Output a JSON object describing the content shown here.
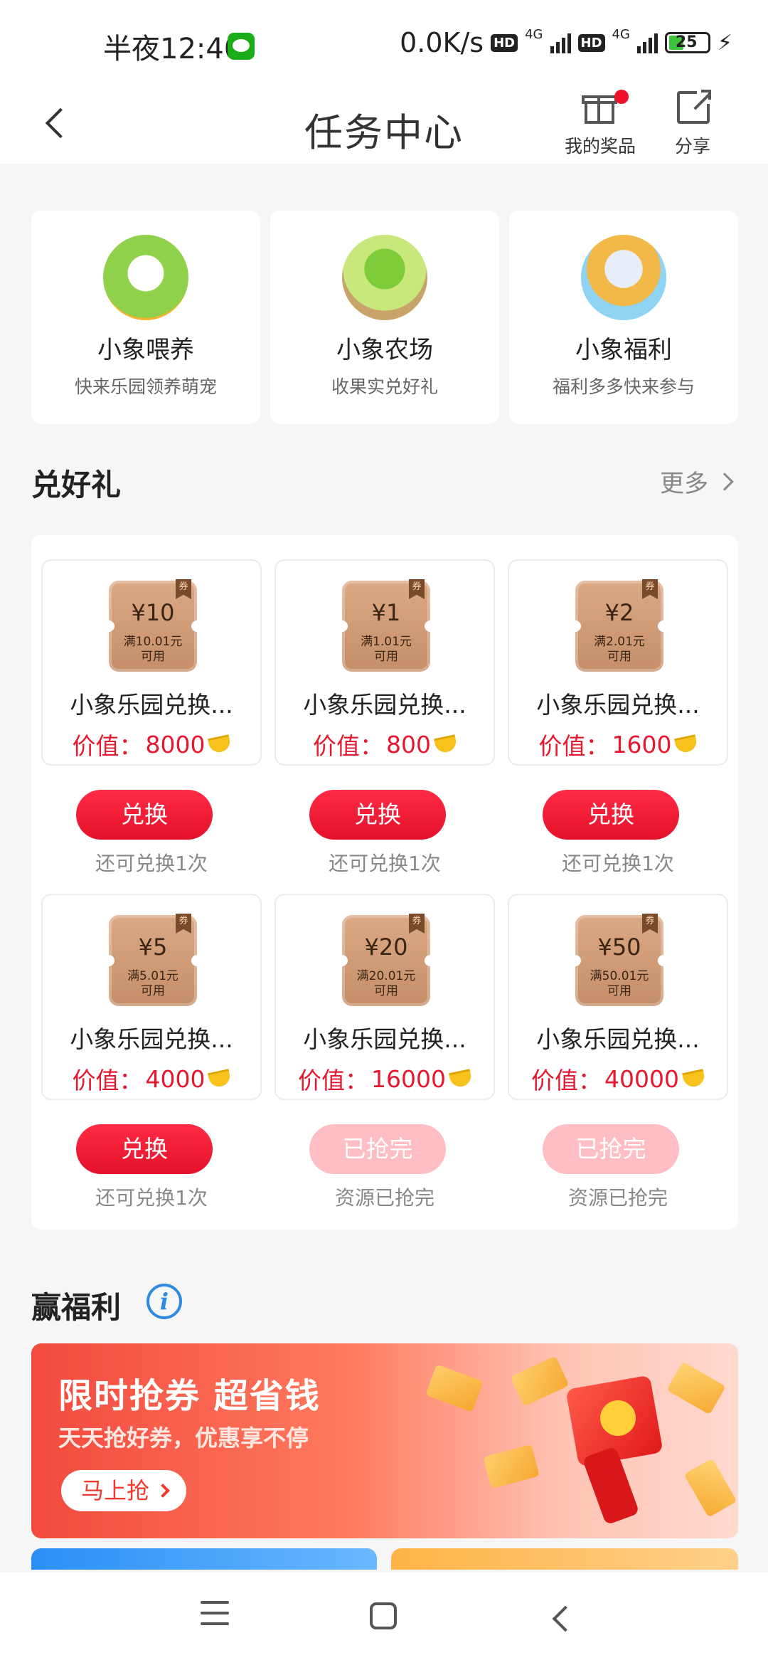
{
  "status_bar": {
    "time": "半夜12:40",
    "speed": "0.0K/s",
    "network_1": "4G",
    "network_2": "4G",
    "hd_1": "HD",
    "hd_2": "HD",
    "battery": "25"
  },
  "header": {
    "title": "任务中心",
    "my_prizes_label": "我的奖品",
    "share_label": "分享"
  },
  "games": [
    {
      "name": "小象喂养",
      "desc": "快来乐园领养萌宠"
    },
    {
      "name": "小象农场",
      "desc": "收果实兑好礼"
    },
    {
      "name": "小象福利",
      "desc": "福利多多快来参与"
    }
  ],
  "exchange": {
    "title": "兑好礼",
    "more_label": "更多",
    "coupon_flag": "券",
    "value_prefix": "价值：",
    "items": [
      {
        "amount": "¥10",
        "condition": "满10.01元",
        "usable": "可用",
        "name": "小象乐园兑换...",
        "value": "8000",
        "button": "兑换",
        "note": "还可兑换1次",
        "sold_out": false
      },
      {
        "amount": "¥1",
        "condition": "满1.01元",
        "usable": "可用",
        "name": "小象乐园兑换...",
        "value": "800",
        "button": "兑换",
        "note": "还可兑换1次",
        "sold_out": false
      },
      {
        "amount": "¥2",
        "condition": "满2.01元",
        "usable": "可用",
        "name": "小象乐园兑换...",
        "value": "1600",
        "button": "兑换",
        "note": "还可兑换1次",
        "sold_out": false
      },
      {
        "amount": "¥5",
        "condition": "满5.01元",
        "usable": "可用",
        "name": "小象乐园兑换...",
        "value": "4000",
        "button": "兑换",
        "note": "还可兑换1次",
        "sold_out": false
      },
      {
        "amount": "¥20",
        "condition": "满20.01元",
        "usable": "可用",
        "name": "小象乐园兑换...",
        "value": "16000",
        "button": "已抢完",
        "note": "资源已抢完",
        "sold_out": true
      },
      {
        "amount": "¥50",
        "condition": "满50.01元",
        "usable": "可用",
        "name": "小象乐园兑换...",
        "value": "40000",
        "button": "已抢完",
        "note": "资源已抢完",
        "sold_out": true
      }
    ]
  },
  "welfare": {
    "title": "赢福利",
    "banner_title": "限时抢券 超省钱",
    "banner_subtitle": "天天抢好券，优惠享不停",
    "banner_button": "马上抢"
  },
  "colors": {
    "accent_red": "#e5182f",
    "sold_out_pink": "#ffbdc4",
    "info_blue": "#2f8ae0"
  }
}
